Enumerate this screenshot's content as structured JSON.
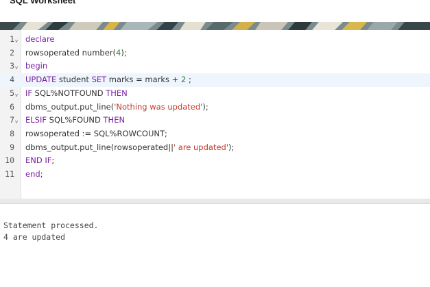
{
  "window": {
    "title": "SQL Worksheet"
  },
  "editor": {
    "lines": [
      {
        "num": "1",
        "fold": "v",
        "parts": [
          {
            "t": "declare",
            "c": "kw"
          }
        ]
      },
      {
        "num": "2",
        "fold": "",
        "parts": [
          {
            "t": "rowsoperated number(",
            "c": ""
          },
          {
            "t": "4",
            "c": "num"
          },
          {
            "t": ");",
            "c": ""
          }
        ]
      },
      {
        "num": "3",
        "fold": "v",
        "parts": [
          {
            "t": "begin",
            "c": "kw"
          }
        ]
      },
      {
        "num": "4",
        "fold": "",
        "parts": [
          {
            "t": "UPDATE",
            "c": "kw"
          },
          {
            "t": " student ",
            "c": ""
          },
          {
            "t": "SET",
            "c": "kw"
          },
          {
            "t": " marks = marks + ",
            "c": ""
          },
          {
            "t": "2",
            "c": "num"
          },
          {
            "t": " ;",
            "c": ""
          }
        ]
      },
      {
        "num": "5",
        "fold": "v",
        "parts": [
          {
            "t": "IF",
            "c": "kw"
          },
          {
            "t": " SQL%NOTFOUND ",
            "c": ""
          },
          {
            "t": "THEN",
            "c": "kw"
          }
        ]
      },
      {
        "num": "6",
        "fold": "",
        "parts": [
          {
            "t": "dbms_output.put_line(",
            "c": ""
          },
          {
            "t": "'Nothing was updated'",
            "c": "str"
          },
          {
            "t": ");",
            "c": ""
          }
        ]
      },
      {
        "num": "7",
        "fold": "v",
        "parts": [
          {
            "t": "ELSIF",
            "c": "kw"
          },
          {
            "t": " SQL%FOUND ",
            "c": ""
          },
          {
            "t": "THEN",
            "c": "kw"
          }
        ]
      },
      {
        "num": "8",
        "fold": "",
        "parts": [
          {
            "t": "rowsoperated := SQL%ROWCOUNT;",
            "c": ""
          }
        ]
      },
      {
        "num": "9",
        "fold": "",
        "parts": [
          {
            "t": "dbms_output.put_line(rowsoperated||",
            "c": ""
          },
          {
            "t": "' are updated'",
            "c": "str"
          },
          {
            "t": ");",
            "c": ""
          }
        ]
      },
      {
        "num": "10",
        "fold": "",
        "parts": [
          {
            "t": "END IF",
            "c": "kw"
          },
          {
            "t": ";",
            "c": ""
          }
        ]
      },
      {
        "num": "11",
        "fold": "",
        "parts": [
          {
            "t": "end",
            "c": "kw"
          },
          {
            "t": ";",
            "c": ""
          }
        ]
      }
    ],
    "active_line": 4
  },
  "output": {
    "lines": [
      "Statement processed.",
      "4 are updated"
    ]
  },
  "colors": {
    "keyword": "#7a1fa2",
    "string": "#c0392b",
    "number": "#2e7d32",
    "active_line": "#eef5fd"
  }
}
